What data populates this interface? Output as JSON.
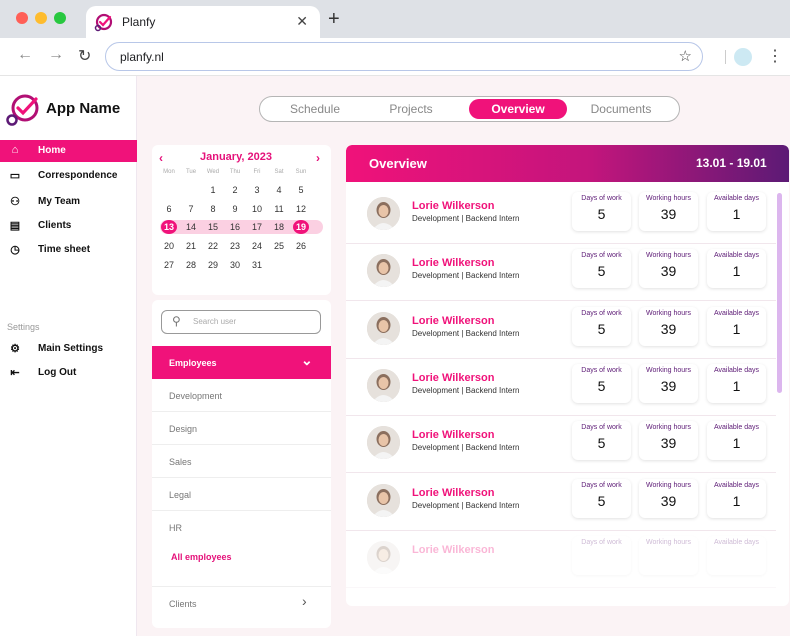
{
  "browser": {
    "tab_title": "Planfy",
    "url": "planfy.nl",
    "traffic_colors": [
      "#ff5f57",
      "#febc2e",
      "#28c840"
    ]
  },
  "app": {
    "name": "App Name",
    "accent": "#f0127a",
    "accent_dark": "#5c1a75"
  },
  "sidebar": {
    "items": [
      {
        "label": "Home",
        "icon": "home-icon",
        "active": true
      },
      {
        "label": "Correspondence",
        "icon": "message-icon",
        "active": false
      },
      {
        "label": "My Team",
        "icon": "team-icon",
        "active": false
      },
      {
        "label": "Clients",
        "icon": "building-icon",
        "active": false
      },
      {
        "label": "Time sheet",
        "icon": "clock-icon",
        "active": false
      }
    ],
    "settings_label": "Settings",
    "settings_items": [
      {
        "label": "Main Settings",
        "icon": "gear-icon"
      },
      {
        "label": "Log Out",
        "icon": "logout-icon"
      }
    ]
  },
  "tabs": [
    {
      "label": "Schedule",
      "active": false
    },
    {
      "label": "Projects",
      "active": false
    },
    {
      "label": "Overview",
      "active": true
    },
    {
      "label": "Documents",
      "active": false
    }
  ],
  "calendar": {
    "title": "January, 2023",
    "prev": "‹",
    "next": "›",
    "weekdays": [
      "Mon",
      "Tue",
      "Wed",
      "Thu",
      "Fri",
      "Sat",
      "Sun"
    ],
    "weeks": [
      [
        "",
        "",
        "1",
        "2",
        "3",
        "4",
        "5"
      ],
      [
        "6",
        "7",
        "8",
        "9",
        "10",
        "11",
        "12"
      ],
      [
        "13",
        "14",
        "15",
        "16",
        "17",
        "18",
        "19"
      ],
      [
        "20",
        "21",
        "22",
        "23",
        "24",
        "25",
        "26"
      ],
      [
        "27",
        "28",
        "29",
        "30",
        "31",
        "",
        ""
      ]
    ],
    "range_start": "13",
    "range_end": "19"
  },
  "filter": {
    "search_placeholder": "Search user",
    "group_label": "Employees",
    "departments": [
      "Development",
      "Design",
      "Sales",
      "Legal",
      "HR"
    ],
    "all_label": "All employees",
    "clients_label": "Clients"
  },
  "overview": {
    "title": "Overview",
    "date_range": "13.01 - 19.01",
    "stat_labels": [
      "Days of work",
      "Working hours",
      "Available days"
    ],
    "employees": [
      {
        "name": "Lorie Wilkerson",
        "role": "Development | Backend Intern",
        "days": "5",
        "hours": "39",
        "available": "1"
      },
      {
        "name": "Lorie Wilkerson",
        "role": "Development | Backend Intern",
        "days": "5",
        "hours": "39",
        "available": "1"
      },
      {
        "name": "Lorie Wilkerson",
        "role": "Development | Backend Intern",
        "days": "5",
        "hours": "39",
        "available": "1"
      },
      {
        "name": "Lorie Wilkerson",
        "role": "Development | Backend Intern",
        "days": "5",
        "hours": "39",
        "available": "1"
      },
      {
        "name": "Lorie Wilkerson",
        "role": "Development | Backend Intern",
        "days": "5",
        "hours": "39",
        "available": "1"
      },
      {
        "name": "Lorie Wilkerson",
        "role": "Development | Backend Intern",
        "days": "5",
        "hours": "39",
        "available": "1"
      },
      {
        "name": "Lorie Wilkerson",
        "role": "",
        "days": "",
        "hours": "",
        "available": ""
      }
    ]
  }
}
